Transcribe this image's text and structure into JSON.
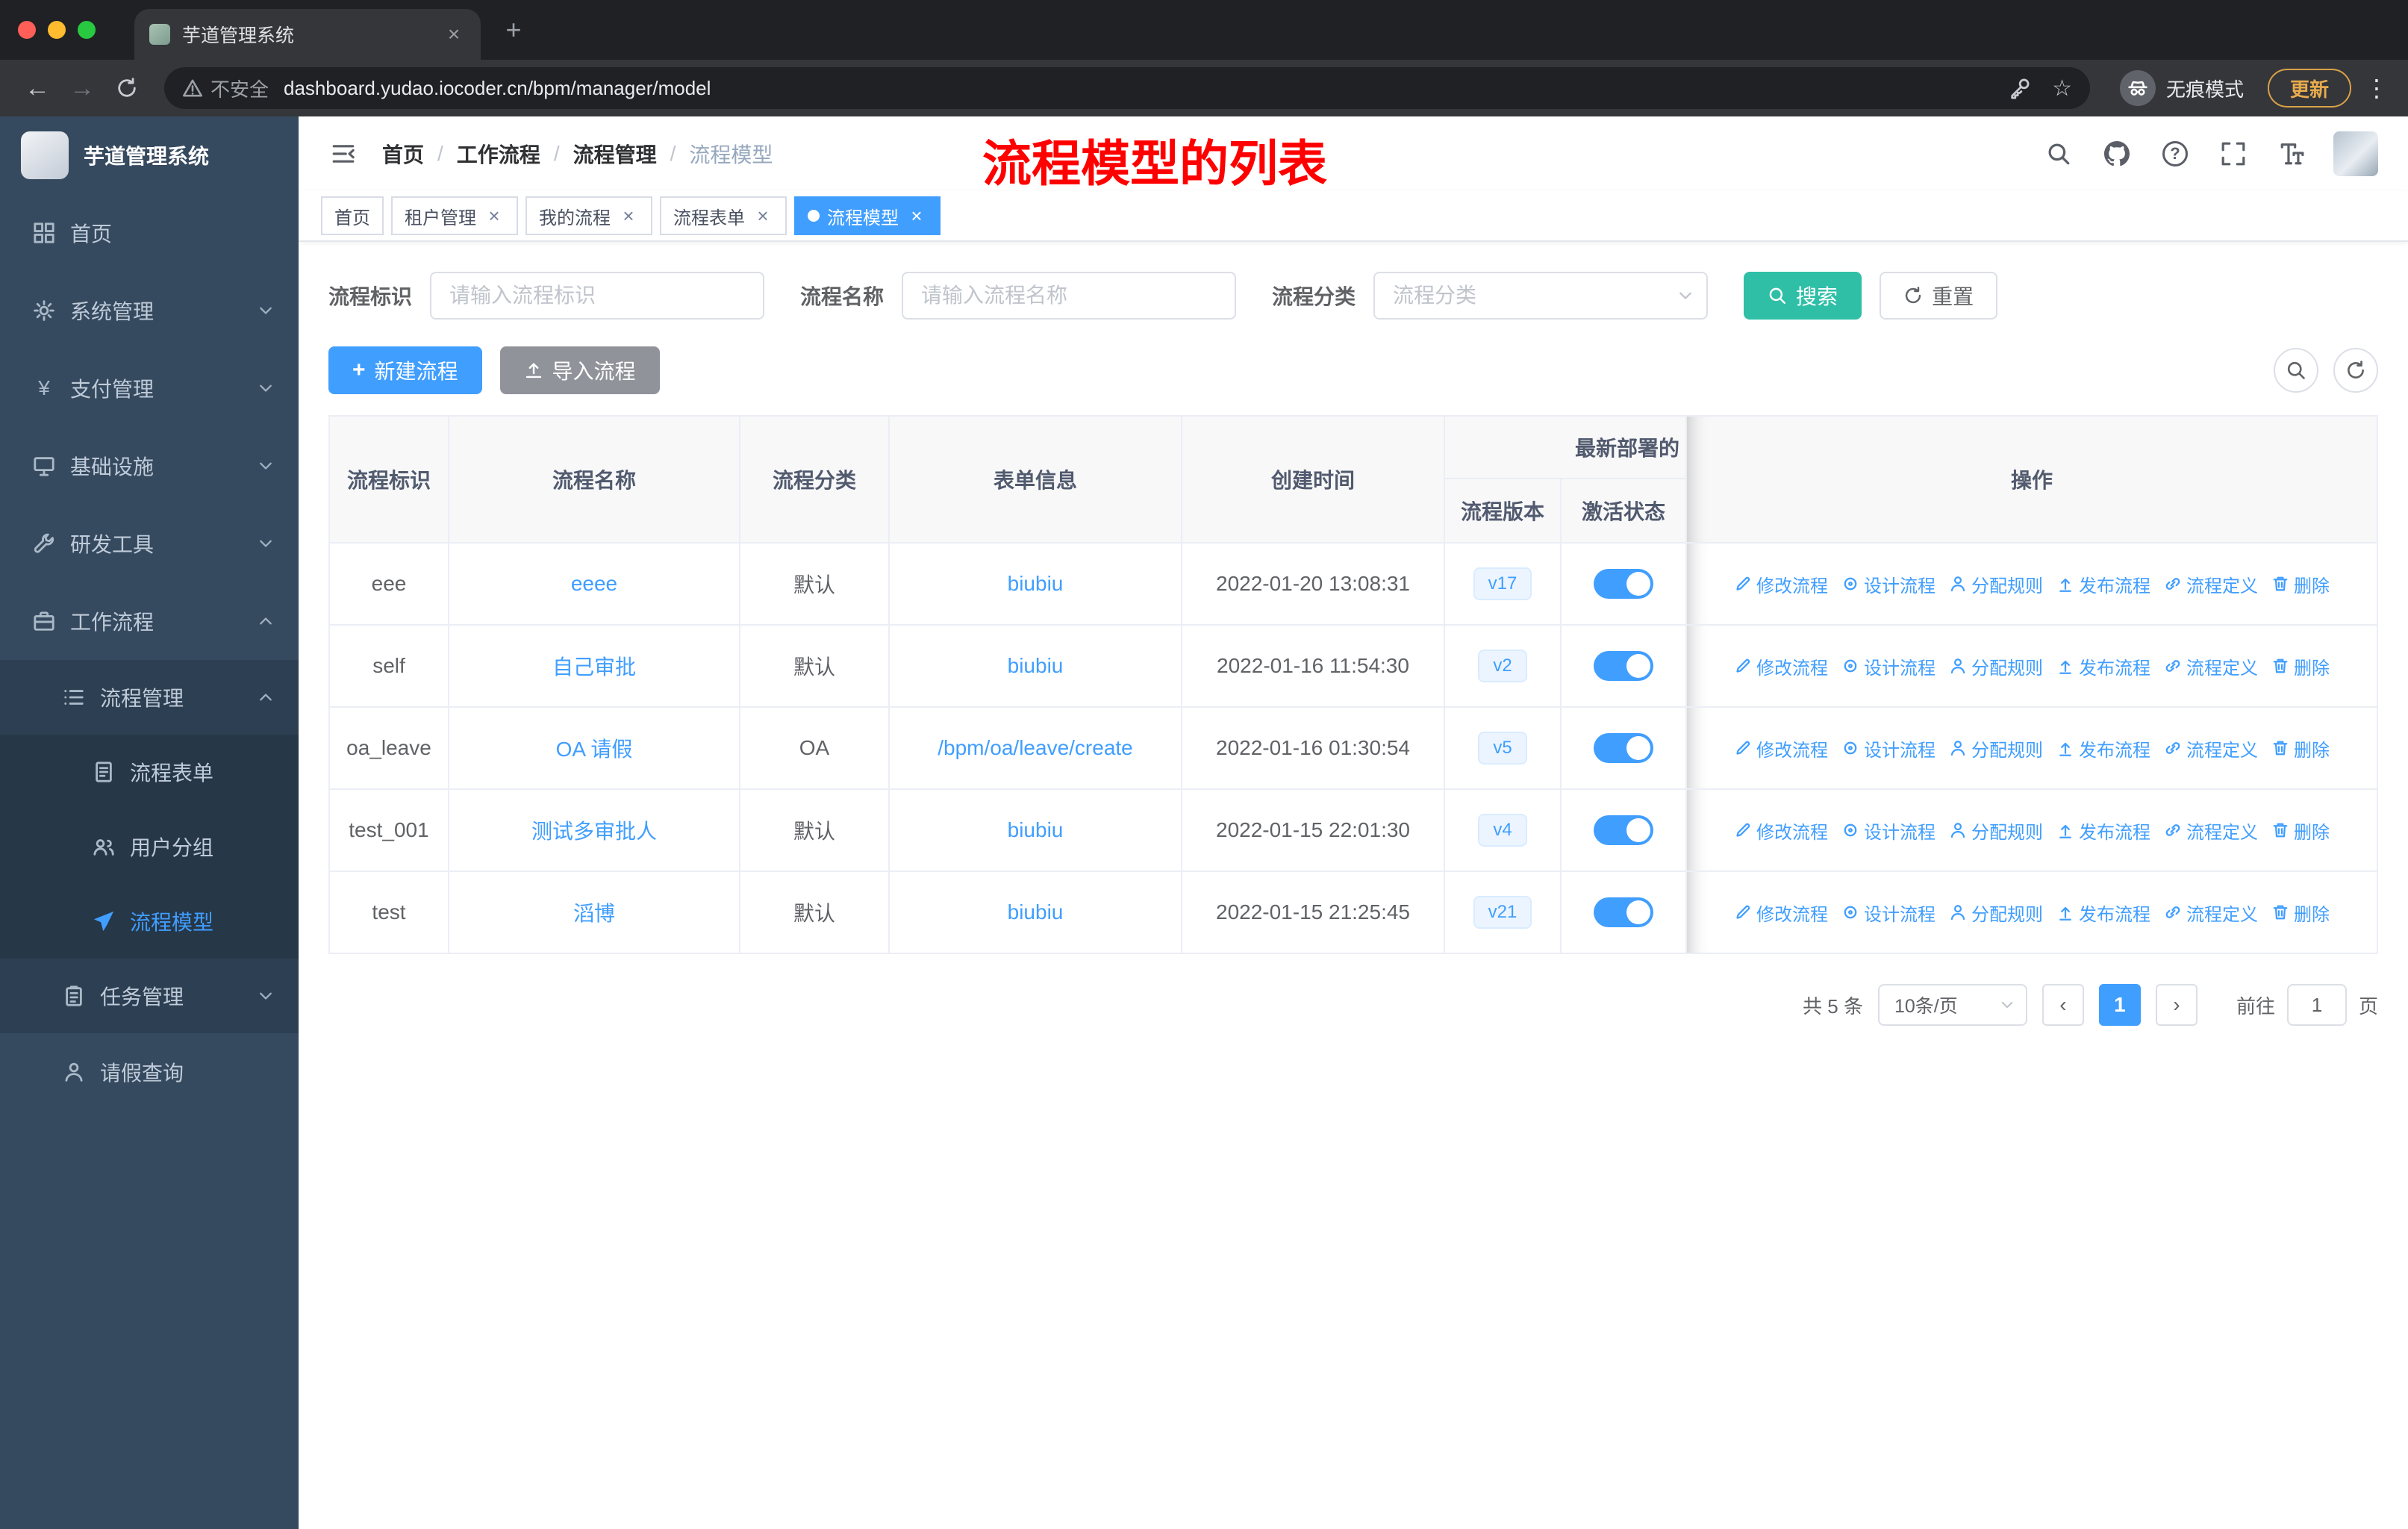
{
  "icons": {
    "close": "×",
    "plus": "+",
    "kebab": "⋮",
    "back": "←",
    "forward": "→",
    "star": "☆",
    "question": "?",
    "slash": "/",
    "prev": "‹",
    "next": "›",
    "yen": "¥"
  },
  "colors": {
    "primary": "#409eff",
    "search_button": "#2fbfa7",
    "annotation_red": "#ff0000",
    "sidebar_bg": "#364a5f",
    "toggle_on": "#409eff",
    "tag_active": "#409eff"
  },
  "browser": {
    "tab_title": "芋道管理系统",
    "security_label": "不安全",
    "url": "dashboard.yudao.iocoder.cn/bpm/manager/model",
    "incognito_label": "无痕模式",
    "update_label": "更新"
  },
  "annotation": "流程模型的列表",
  "sidebar": {
    "logo_title": "芋道管理系统",
    "home": "首页",
    "system": "系统管理",
    "payment": "支付管理",
    "infra": "基础设施",
    "devtools": "研发工具",
    "workflow": "工作流程",
    "process_mgmt": "流程管理",
    "process_form": "流程表单",
    "user_group": "用户分组",
    "process_model": "流程模型",
    "task_mgmt": "任务管理",
    "leave_query": "请假查询"
  },
  "breadcrumb": {
    "items": [
      "首页",
      "工作流程",
      "流程管理",
      "流程模型"
    ]
  },
  "tags": {
    "home": "首页",
    "tenant": "租户管理",
    "my_process": "我的流程",
    "process_form": "流程表单",
    "process_model": "流程模型"
  },
  "filters": {
    "id_label": "流程标识",
    "id_placeholder": "请输入流程标识",
    "name_label": "流程名称",
    "name_placeholder": "请输入流程名称",
    "category_label": "流程分类",
    "category_placeholder": "流程分类",
    "search_label": "搜索",
    "reset_label": "重置"
  },
  "toolbar": {
    "create_label": "新建流程",
    "import_label": "导入流程"
  },
  "table": {
    "headers": {
      "id": "流程标识",
      "name": "流程名称",
      "category": "流程分类",
      "form": "表单信息",
      "created": "创建时间",
      "deploy_group": "最新部署的",
      "version": "流程版本",
      "active": "激活状态",
      "ops": "操作"
    },
    "op_labels": [
      "修改流程",
      "设计流程",
      "分配规则",
      "发布流程",
      "流程定义",
      "删除"
    ],
    "rows": [
      {
        "id": "eee",
        "name": "eeee",
        "category": "默认",
        "form": "biubiu",
        "created": "2022-01-20 13:08:31",
        "version": "v17"
      },
      {
        "id": "self",
        "name": "自己审批",
        "category": "默认",
        "form": "biubiu",
        "created": "2022-01-16 11:54:30",
        "version": "v2"
      },
      {
        "id": "oa_leave",
        "name": "OA 请假",
        "category": "OA",
        "form": "/bpm/oa/leave/create",
        "created": "2022-01-16 01:30:54",
        "version": "v5"
      },
      {
        "id": "test_001",
        "name": "测试多审批人",
        "category": "默认",
        "form": "biubiu",
        "created": "2022-01-15 22:01:30",
        "version": "v4"
      },
      {
        "id": "test",
        "name": "滔博",
        "category": "默认",
        "form": "biubiu",
        "created": "2022-01-15 21:25:45",
        "version": "v21"
      }
    ]
  },
  "pagination": {
    "total": "共 5 条",
    "page_size": "10条/页",
    "current": "1",
    "goto_label": "前往",
    "goto_value": "1",
    "unit_label": "页"
  }
}
